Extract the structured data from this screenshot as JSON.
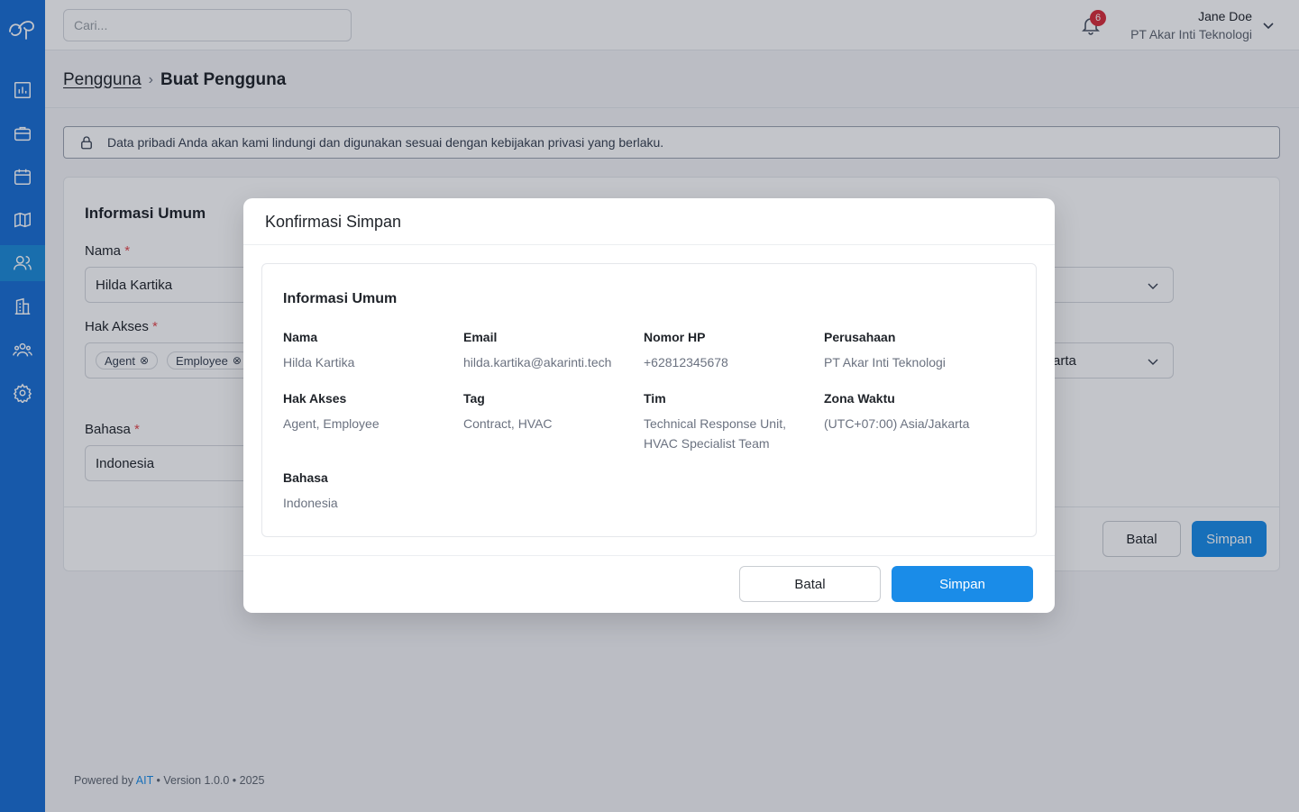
{
  "topbar": {
    "search_placeholder": "Cari...",
    "notification_count": "6",
    "user_name": "Jane Doe",
    "user_company": "PT Akar Inti Teknologi"
  },
  "breadcrumb": {
    "parent": "Pengguna",
    "separator": "›",
    "current": "Buat Pengguna"
  },
  "notice": "Data pribadi Anda akan kami lindungi dan digunakan sesuai dengan kebijakan privasi yang berlaku.",
  "form": {
    "section_title": "Informasi Umum",
    "name_label": "Nama",
    "name_value": "Hilda Kartika",
    "access_label": "Hak Akses",
    "access_chips": [
      "Agent",
      "Employee"
    ],
    "chip_remove": "⊗",
    "language_label": "Bahasa",
    "language_value": "Indonesia",
    "timezone_partial": "arta",
    "required_mark": "*",
    "cancel_label": "Batal",
    "save_label": "Simpan"
  },
  "footer": {
    "prefix": "Powered by ",
    "brand": "AIT",
    "suffix": " • Version 1.0.0 • 2025"
  },
  "modal": {
    "title": "Konfirmasi Simpan",
    "section_title": "Informasi Umum",
    "fields": {
      "name": {
        "label": "Nama",
        "value": "Hilda Kartika"
      },
      "email": {
        "label": "Email",
        "value": "hilda.kartika@akarinti.tech"
      },
      "phone": {
        "label": "Nomor HP",
        "value": "+62812345678"
      },
      "company": {
        "label": "Perusahaan",
        "value": "PT Akar Inti Teknologi"
      },
      "access": {
        "label": "Hak Akses",
        "value": "Agent, Employee"
      },
      "tag": {
        "label": "Tag",
        "value": "Contract, HVAC"
      },
      "team": {
        "label": "Tim",
        "value_line1": "Technical Response Unit,",
        "value_line2": "HVAC Specialist Team"
      },
      "timezone": {
        "label": "Zona Waktu",
        "value": "(UTC+07:00) Asia/Jakarta"
      },
      "language": {
        "label": "Bahasa",
        "value": "Indonesia"
      }
    },
    "cancel_label": "Batal",
    "save_label": "Simpan"
  },
  "colors": {
    "sidebar": "#1a6fd4",
    "primary": "#1a8ce8",
    "badge": "#d92d3a"
  },
  "icons": [
    "logo-icon",
    "dashboard-icon",
    "briefcase-icon",
    "calendar-icon",
    "map-icon",
    "users-icon",
    "building-icon",
    "team-icon",
    "settings-icon",
    "bell-icon",
    "chevron-down-icon",
    "lock-icon"
  ]
}
